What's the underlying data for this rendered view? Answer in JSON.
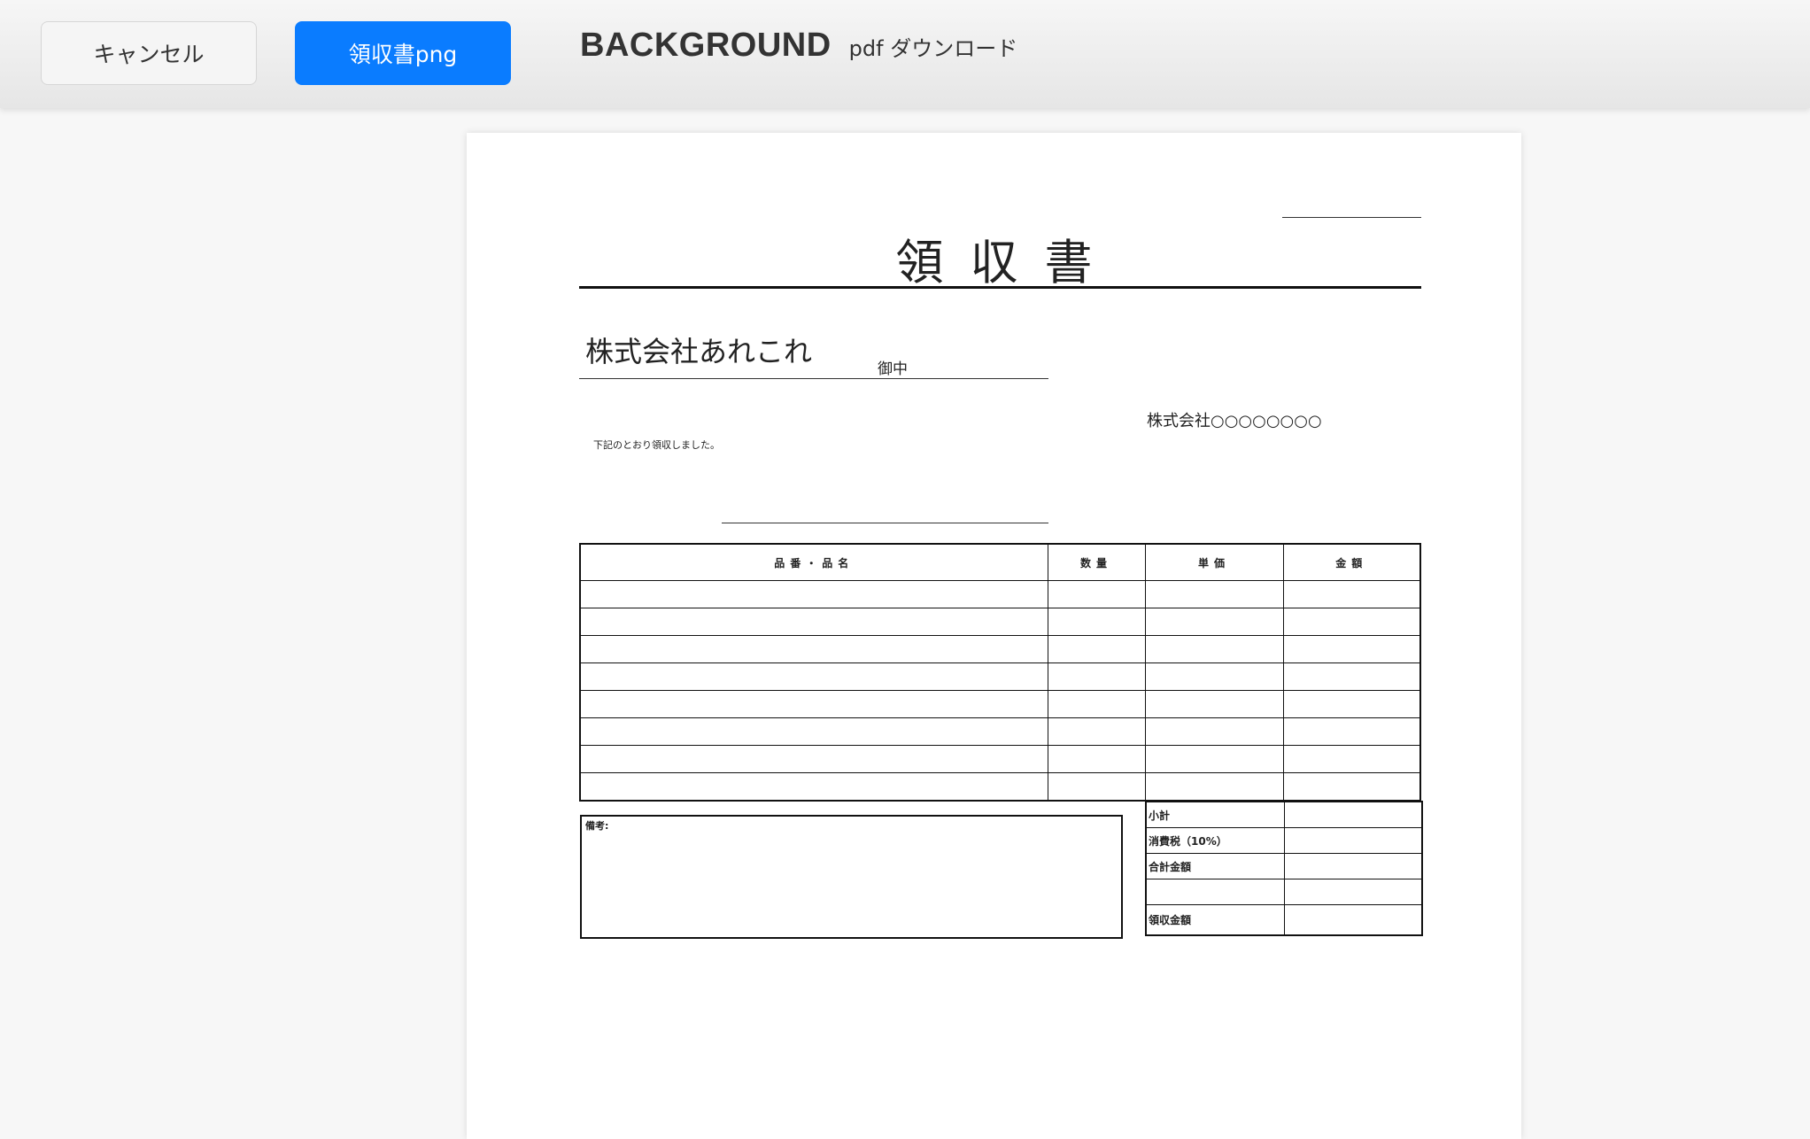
{
  "toolbar": {
    "cancel_label": "キャンセル",
    "download_png_label": "領収書png",
    "app_title": "BACKGROUND",
    "app_subtitle": "pdf ダウンロード"
  },
  "colors": {
    "primary": "#0a7cff",
    "toolbar_bg": "#ededed",
    "page_bg": "#f7f7f7"
  },
  "receipt": {
    "title": "領収書",
    "recipient_name": "株式会社あれこれ",
    "honorific": "御中",
    "issuer": "株式会社○○○○○○○○",
    "note": "下記のとおり領収しました。",
    "table_headers": [
      "品番・品名",
      "数量",
      "単価",
      "金額"
    ],
    "remarks_label": "備考:",
    "summary_labels": [
      "小計",
      "消費税（10%）",
      "合計金額",
      "",
      "領収金額"
    ]
  }
}
